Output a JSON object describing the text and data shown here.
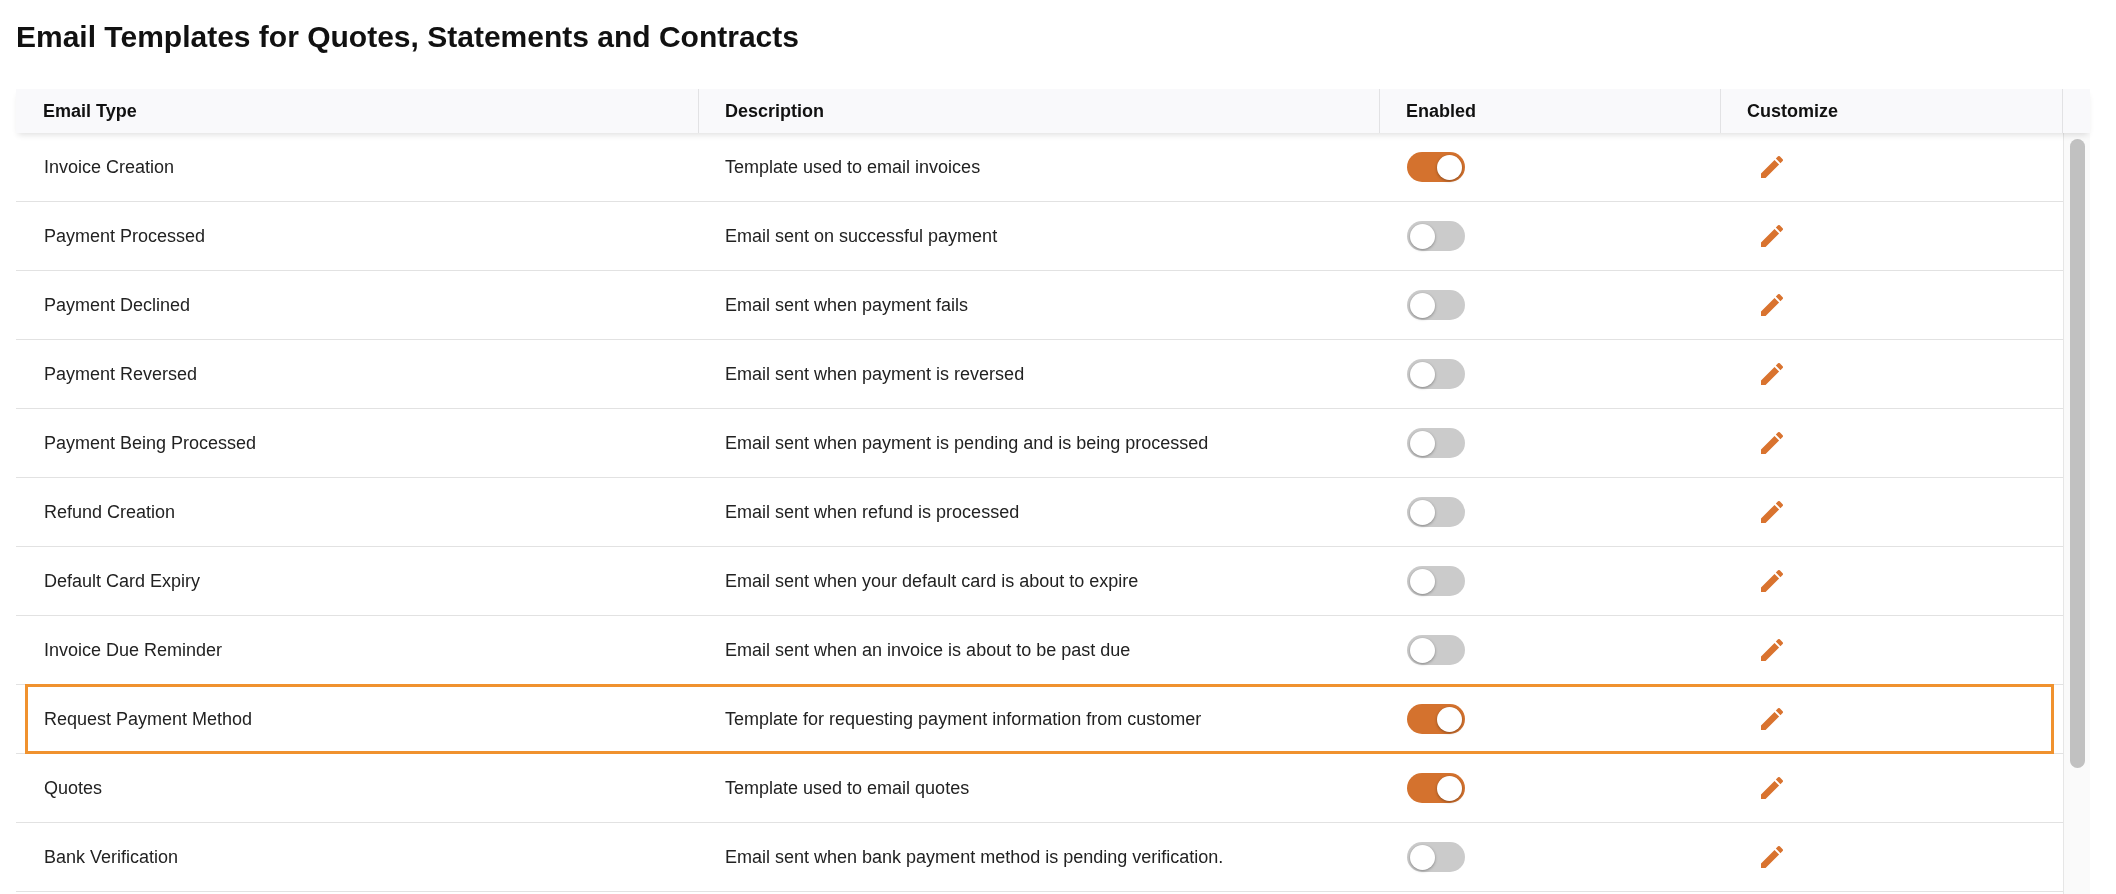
{
  "title": "Email Templates for Quotes, Statements and Contracts",
  "table": {
    "columns": [
      "Email Type",
      "Description",
      "Enabled",
      "Customize"
    ],
    "rows": [
      {
        "email_type": "Invoice Creation",
        "description": "Template used to email invoices",
        "enabled": true,
        "highlighted": false
      },
      {
        "email_type": "Payment Processed",
        "description": "Email sent on successful payment",
        "enabled": false,
        "highlighted": false
      },
      {
        "email_type": "Payment Declined",
        "description": "Email sent when payment fails",
        "enabled": false,
        "highlighted": false
      },
      {
        "email_type": "Payment Reversed",
        "description": "Email sent when payment is reversed",
        "enabled": false,
        "highlighted": false
      },
      {
        "email_type": "Payment Being Processed",
        "description": "Email sent when payment is pending and is being processed",
        "enabled": false,
        "highlighted": false
      },
      {
        "email_type": "Refund Creation",
        "description": "Email sent when refund is processed",
        "enabled": false,
        "highlighted": false
      },
      {
        "email_type": "Default Card Expiry",
        "description": "Email sent when your default card is about to expire",
        "enabled": false,
        "highlighted": false
      },
      {
        "email_type": "Invoice Due Reminder",
        "description": "Email sent when an invoice is about to be past due",
        "enabled": false,
        "highlighted": false
      },
      {
        "email_type": "Request Payment Method",
        "description": "Template for requesting payment information from customer",
        "enabled": true,
        "highlighted": true
      },
      {
        "email_type": "Quotes",
        "description": "Template used to email quotes",
        "enabled": true,
        "highlighted": false
      },
      {
        "email_type": "Bank Verification",
        "description": "Email sent when bank payment method is pending verification.",
        "enabled": false,
        "highlighted": false
      }
    ]
  }
}
